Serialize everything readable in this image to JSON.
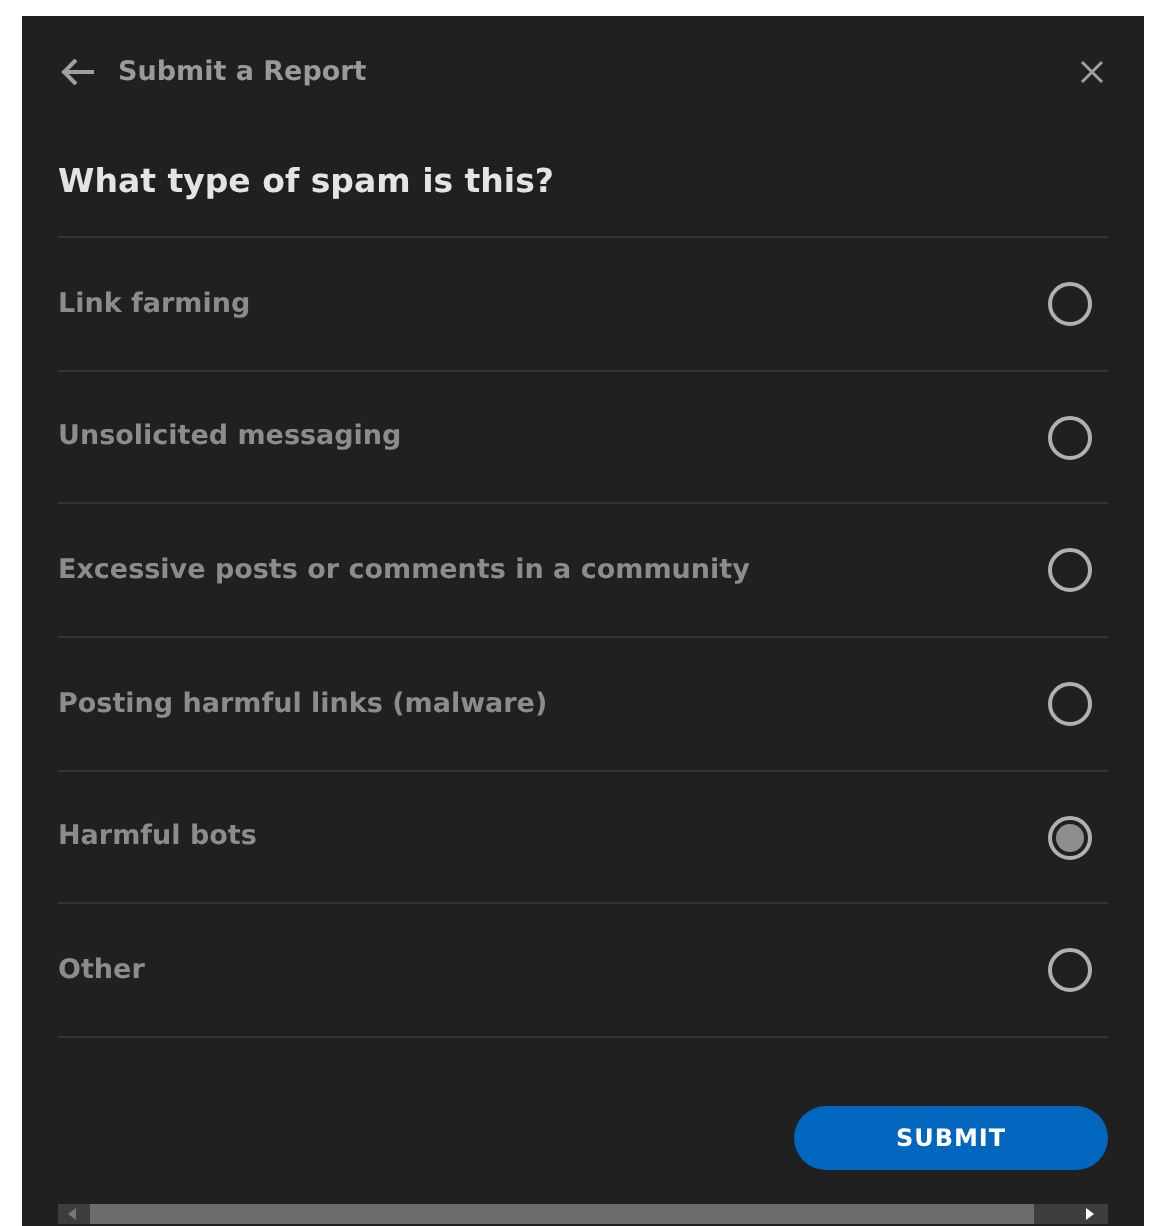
{
  "header": {
    "title": "Submit a Report"
  },
  "question": "What type of spam is this?",
  "options": [
    {
      "label": "Link farming",
      "selected": false
    },
    {
      "label": "Unsolicited messaging",
      "selected": false
    },
    {
      "label": "Excessive posts or comments in a community",
      "selected": false
    },
    {
      "label": "Posting harmful links (malware)",
      "selected": false
    },
    {
      "label": "Harmful bots",
      "selected": true
    },
    {
      "label": "Other",
      "selected": false
    }
  ],
  "submit_button": "SUBMIT"
}
